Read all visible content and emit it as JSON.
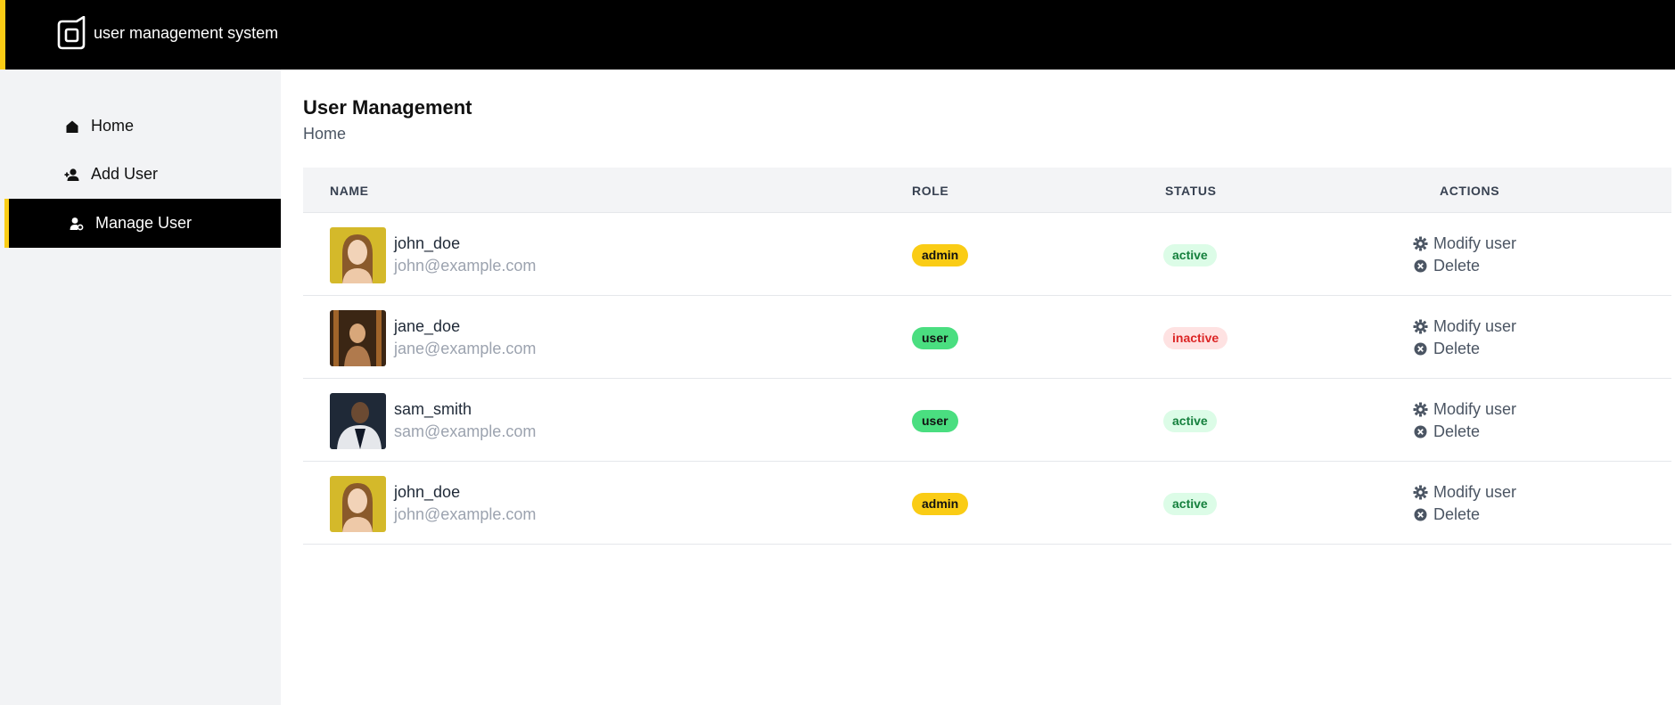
{
  "app": {
    "title": "user management system"
  },
  "sidebar": {
    "items": [
      {
        "label": "Home",
        "icon": "home-icon",
        "active": false
      },
      {
        "label": "Add User",
        "icon": "add-user-icon",
        "active": false
      },
      {
        "label": "Manage User",
        "icon": "manage-user-icon",
        "active": true
      }
    ]
  },
  "main": {
    "title": "User Management",
    "breadcrumb": "Home",
    "table": {
      "headers": [
        "NAME",
        "ROLE",
        "STATUS",
        "ACTIONS"
      ],
      "rows": [
        {
          "username": "john_doe",
          "email": "john@example.com",
          "role": "admin",
          "status": "active",
          "modify_label": "Modify user",
          "delete_label": "Delete"
        },
        {
          "username": "jane_doe",
          "email": "jane@example.com",
          "role": "user",
          "status": "inactive",
          "modify_label": "Modify user",
          "delete_label": "Delete"
        },
        {
          "username": "sam_smith",
          "email": "sam@example.com",
          "role": "user",
          "status": "active",
          "modify_label": "Modify user",
          "delete_label": "Delete"
        },
        {
          "username": "john_doe",
          "email": "john@example.com",
          "role": "admin",
          "status": "active",
          "modify_label": "Modify user",
          "delete_label": "Delete"
        }
      ]
    }
  },
  "colors": {
    "accent": "#facc15",
    "header_bg": "#000000",
    "sidebar_bg": "#f2f3f5",
    "role_admin": "#facc15",
    "role_user": "#4ade80",
    "status_active_bg": "#dcfce7",
    "status_active_text": "#15803d",
    "status_inactive_bg": "#fee2e2",
    "status_inactive_text": "#dc2626"
  }
}
